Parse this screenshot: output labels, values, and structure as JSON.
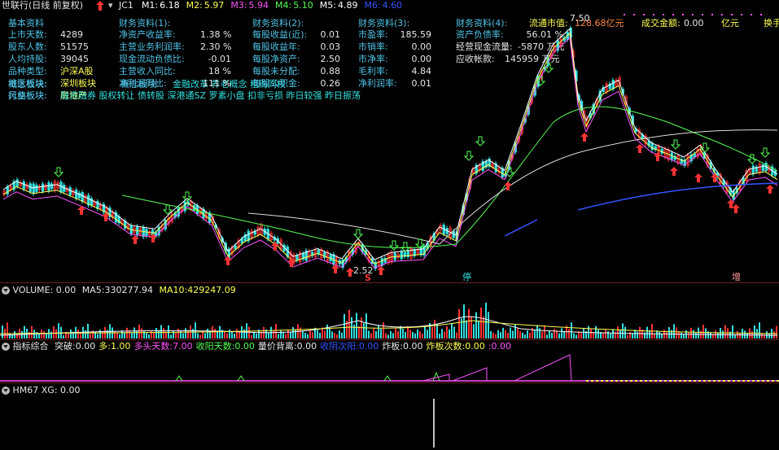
{
  "header": {
    "stock_title": "世联行(日线 前复权)",
    "indicators": [
      {
        "label": "JC1",
        "value": "",
        "color": "#e6e6e6"
      },
      {
        "label": "M1:",
        "value": "6.18",
        "color": "#ffffff"
      },
      {
        "label": "M2:",
        "value": "5.97",
        "color": "#ffff55"
      },
      {
        "label": "M3:",
        "value": "5.94",
        "color": "#ff55ff"
      },
      {
        "label": "M4:",
        "value": "5.10",
        "color": "#55ff55"
      },
      {
        "label": "M5:",
        "value": "4.89",
        "color": "#ffffff"
      },
      {
        "label": "M6:",
        "value": "4.60",
        "color": "#3355ff"
      }
    ]
  },
  "finance": {
    "col0_title": "基本资料",
    "col0": [
      {
        "label": "上市天数:",
        "value": "4289"
      },
      {
        "label": "股东人数:",
        "value": "51575"
      },
      {
        "label": "人均持股:",
        "value": "39045"
      },
      {
        "label": "品种类型:",
        "value": "沪深A股"
      },
      {
        "label": "地区板块:",
        "value": "深圳板块"
      },
      {
        "label": "行业板块:",
        "value": "房地产"
      }
    ],
    "concept_label": "概念板块:",
    "concept_value": "金融改革 养老概念 租购同权",
    "style_label": "风格板块:",
    "style_value": "融资融券 股权转让 债转股 深港通SZ 罗素小盘 扣非亏损 昨日较强 昨日振荡",
    "col1_title": "财务资料(1):",
    "col1": [
      {
        "label": "净资产收益率:",
        "value": "1.38 %"
      },
      {
        "label": "主营业务利润率:",
        "value": "2.30 %"
      },
      {
        "label": "现金流动负债比:",
        "value": "-0.01"
      },
      {
        "label": "主营收入同比:",
        "value": "18 %"
      },
      {
        "label": "净利润同比:",
        "value": "111 %"
      }
    ],
    "col2_title": "财务资料(2):",
    "col2": [
      {
        "label": "每股收益(近):",
        "value": "0.01"
      },
      {
        "label": "每股收益年:",
        "value": "0.03"
      },
      {
        "label": "每股净资产:",
        "value": "2.50"
      },
      {
        "label": "每股未分配:",
        "value": "0.88"
      },
      {
        "label": "每股公积金:",
        "value": "0.26"
      }
    ],
    "col3_title": "财务资料(3):",
    "col3": [
      {
        "label": "市盈率:",
        "value": "185.59"
      },
      {
        "label": "市销率:",
        "value": "0.00"
      },
      {
        "label": "市净率:",
        "value": "0.00"
      },
      {
        "label": "毛利率:",
        "value": "4.84"
      },
      {
        "label": "净利润率:",
        "value": "0.01"
      }
    ],
    "col4_title": "财务资料(4):",
    "col4": [
      {
        "label": "资产负债率:",
        "value": "56.01 %"
      },
      {
        "label": "经营现金流量:",
        "value": "-5870 万元"
      },
      {
        "label": "应收帐款:",
        "value": "145959 万元"
      }
    ],
    "market_cap_label": "流通市值:",
    "market_cap_value": "128.68亿元",
    "turnover_label": "成交金额:",
    "turnover_value": "0.00",
    "turnover_unit": "亿元",
    "switch_label": "换手"
  },
  "price_chart": {
    "high_label": "7.50",
    "low_label": "2.52",
    "marker_s": "S",
    "marker_ting": "停",
    "marker_zeng": "增"
  },
  "volume_panel": {
    "label": "VOLUME:",
    "value": "0.00",
    "ma5_label": "MA5:",
    "ma5_value": "330277.94",
    "ma10_label": "MA10:",
    "ma10_value": "429247.09"
  },
  "indicator_panel": {
    "label": "指标综合",
    "items": [
      {
        "label": "突破:",
        "value": "0.00",
        "color": "#e6e6e6"
      },
      {
        "label": "多:",
        "value": "1.00",
        "color": "#ffff55"
      },
      {
        "label": "多头天数:",
        "value": "7.00",
        "color": "#ff55ff"
      },
      {
        "label": "收阳天数:",
        "value": "0.00",
        "color": "#55ff55"
      },
      {
        "label": "量价背离:",
        "value": "0.00",
        "color": "#e6e6e6"
      },
      {
        "label": "收阴次阳:",
        "value": "0.00",
        "color": "#3355ff"
      },
      {
        "label": "炸板:",
        "value": "0.00",
        "color": "#e6e6e6"
      },
      {
        "label": "炸板次数:",
        "value": "0.00",
        "color": "#ffff55"
      },
      {
        "label": ":",
        "value": "0.00",
        "color": "#ff55ff"
      }
    ]
  },
  "hm_panel": {
    "label": "HM67",
    "xg_label": "XG:",
    "xg_value": "0.00"
  },
  "colors": {
    "up": "#ff3333",
    "down": "#33e0e0",
    "ma_white": "#ffffff",
    "ma_yellow": "#ffff55",
    "ma_magenta": "#ff55ff",
    "ma_green": "#55ff55",
    "ma_blue": "#3355ff"
  }
}
